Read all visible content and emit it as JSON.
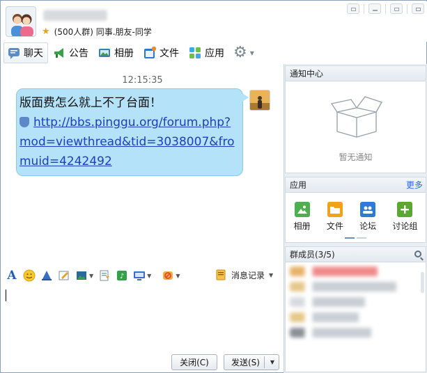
{
  "header": {
    "group_info": "(500人群) 同事.朋友-同学"
  },
  "tabs": [
    {
      "label": "聊天",
      "icon": "chat-icon"
    },
    {
      "label": "公告",
      "icon": "megaphone-icon"
    },
    {
      "label": "相册",
      "icon": "album-icon"
    },
    {
      "label": "文件",
      "icon": "folder-icon"
    },
    {
      "label": "应用",
      "icon": "apps-grid-icon"
    }
  ],
  "chat": {
    "time": "12:15:35",
    "message_text": "版面费怎么就上不了台面！",
    "message_link": "http://bbs.pinggu.org/forum.php?mod=viewthread&tid=3038007&fromuid=4242492"
  },
  "toolbar": {
    "record_label": "消息记录"
  },
  "buttons": {
    "close": "关闭(C)",
    "send": "发送(S)"
  },
  "panel": {
    "notify_title": "通知中心",
    "notify_empty": "暂无通知",
    "apps_title": "应用",
    "apps_more": "更多",
    "apps": [
      {
        "label": "相册",
        "color": "#4caf50"
      },
      {
        "label": "文件",
        "color": "#f0a21a"
      },
      {
        "label": "论坛",
        "color": "#2f7ad6"
      },
      {
        "label": "讨论组",
        "color": "#5aa832"
      }
    ],
    "members_title": "群成员(3/5)"
  },
  "colors": {
    "bubble": "#b4e3f9",
    "link": "#1a3fbf",
    "panel_bg": "#e8eef4"
  }
}
